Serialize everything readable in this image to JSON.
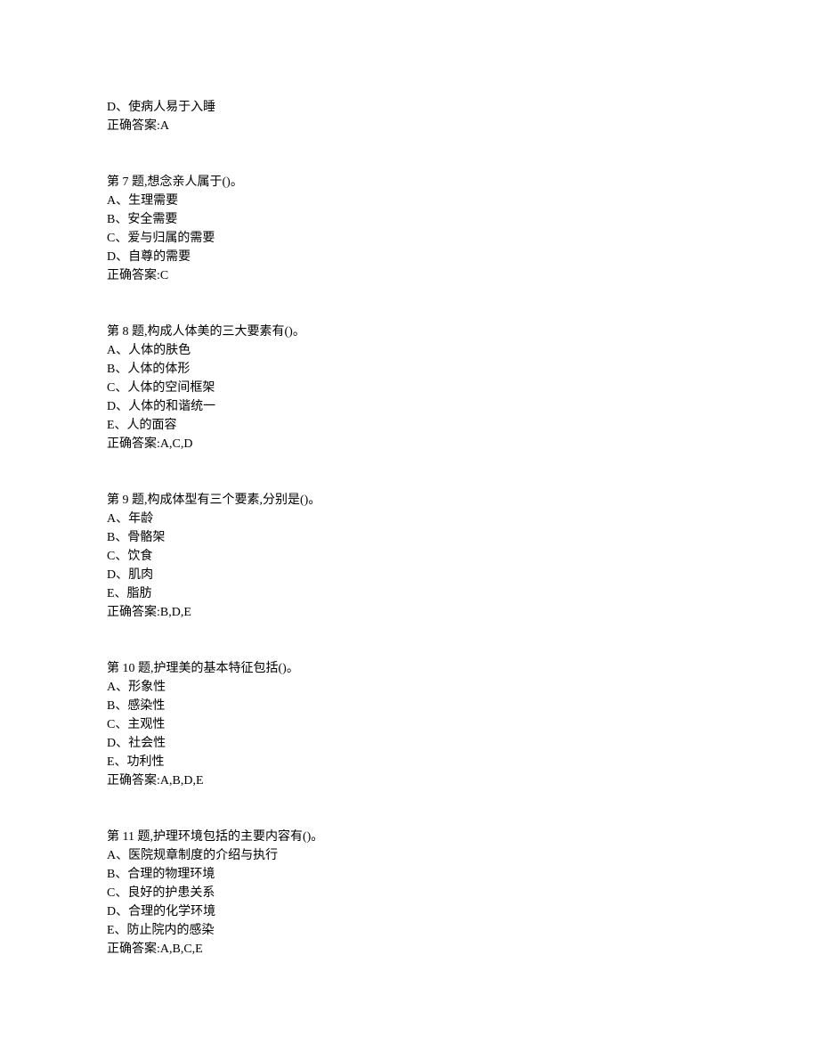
{
  "fragment": {
    "option": "D、使病人易于入睡",
    "answer": "正确答案:A"
  },
  "questions": [
    {
      "title": "第 7 题,想念亲人属于()。",
      "options": [
        "A、生理需要",
        "B、安全需要",
        "C、爱与归属的需要",
        "D、自尊的需要"
      ],
      "answer": "正确答案:C"
    },
    {
      "title": "第 8 题,构成人体美的三大要素有()。",
      "options": [
        "A、人体的肤色",
        "B、人体的体形",
        "C、人体的空间框架",
        "D、人体的和谐统一",
        "E、人的面容"
      ],
      "answer": "正确答案:A,C,D"
    },
    {
      "title": "第 9 题,构成体型有三个要素,分别是()。",
      "options": [
        "A、年龄",
        "B、骨骼架",
        "C、饮食",
        "D、肌肉",
        "E、脂肪"
      ],
      "answer": "正确答案:B,D,E"
    },
    {
      "title": "第 10 题,护理美的基本特征包括()。",
      "options": [
        "A、形象性",
        "B、感染性",
        "C、主观性",
        "D、社会性",
        "E、功利性"
      ],
      "answer": "正确答案:A,B,D,E"
    },
    {
      "title": "第 11 题,护理环境包括的主要内容有()。",
      "options": [
        "A、医院规章制度的介绍与执行",
        "B、合理的物理环境",
        "C、良好的护患关系",
        "D、合理的化学环境",
        "E、防止院内的感染"
      ],
      "answer": "正确答案:A,B,C,E"
    }
  ]
}
